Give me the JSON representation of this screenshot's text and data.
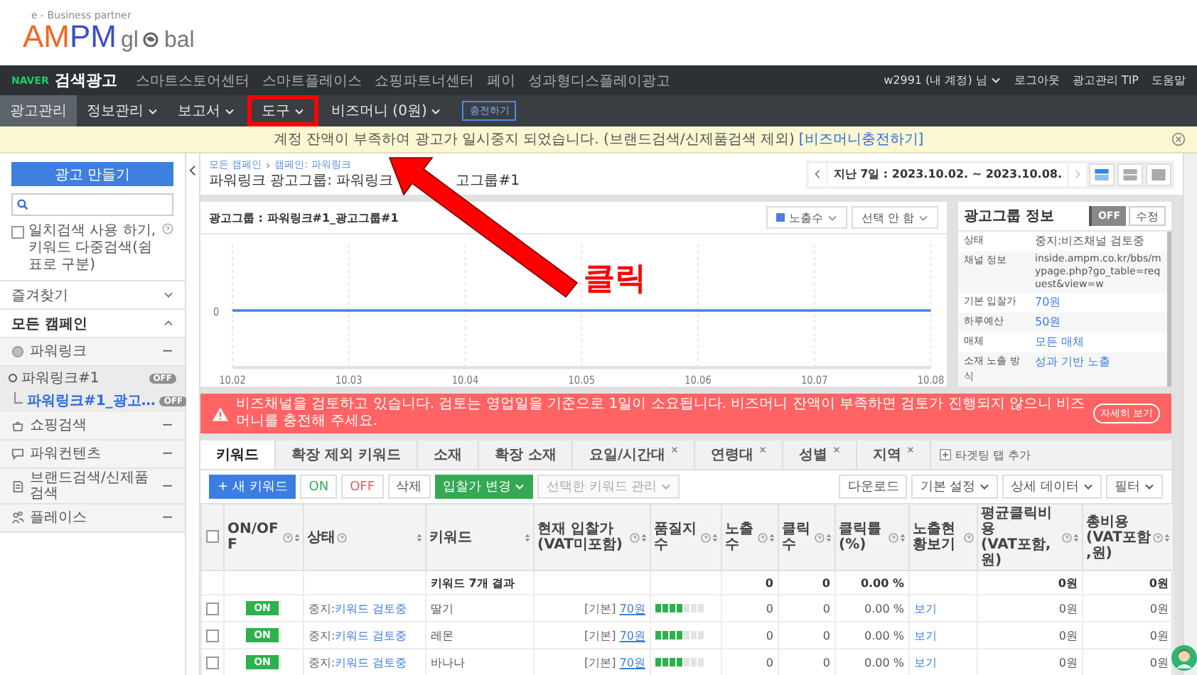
{
  "logo": {
    "tagline": "e - Business partner",
    "brand_a": "AM",
    "brand_b": "PM",
    "word_start": "gl",
    "word_end": "bal"
  },
  "topbar": {
    "brand_mark": "NAVER",
    "brand": "검색광고",
    "links": [
      "스마트스토어센터",
      "스마트플레이스",
      "쇼핑파트너센터",
      "페이",
      "성과형디스플레이광고"
    ],
    "account": "w2991 (내 계정) 님",
    "right_links": [
      "로그아웃",
      "광고관리 TIP",
      "도움말"
    ]
  },
  "nav": {
    "items": [
      {
        "label": "광고관리",
        "dropdown": false,
        "selected": true,
        "highlighted": false
      },
      {
        "label": "정보관리",
        "dropdown": true,
        "selected": false,
        "highlighted": false
      },
      {
        "label": "보고서",
        "dropdown": true,
        "selected": false,
        "highlighted": false
      },
      {
        "label": "도구",
        "dropdown": true,
        "selected": false,
        "highlighted": true
      },
      {
        "label": "비즈머니 (0원)",
        "dropdown": true,
        "selected": false,
        "highlighted": false
      }
    ],
    "charge_button": "충전하기"
  },
  "notice": {
    "text": "계정 잔액이 부족하여 광고가 일시중지 되었습니다. (브랜드검색/신제품검색 제외)",
    "link": "[비즈머니충전하기]"
  },
  "sidebar": {
    "create_button": "광고 만들기",
    "option": {
      "label": "일치검색 사용 하기, 키워드 다중검색(쉼표로 구분)",
      "checked": false
    },
    "sections": [
      {
        "label": "즐겨찾기",
        "expanded": false
      },
      {
        "label": "모든 캠페인",
        "expanded": true
      }
    ],
    "campaign_types": [
      {
        "kind": "circle",
        "label": "파워링크",
        "toggle": "−",
        "children": [
          {
            "label": "파워링크#1",
            "badge": "OFF",
            "selected": false,
            "children": [
              {
                "label": "파워링크#1_광고…",
                "badge": "OFF",
                "selected": true
              }
            ]
          }
        ]
      },
      {
        "kind": "bag",
        "label": "쇼핑검색",
        "toggle": "−"
      },
      {
        "kind": "chat",
        "label": "파워컨텐츠",
        "toggle": "−"
      },
      {
        "kind": "doc",
        "label": "브랜드검색/신제품검색",
        "toggle": "−"
      },
      {
        "kind": "people",
        "label": "플레이스",
        "toggle": "−"
      }
    ]
  },
  "header": {
    "breadcrumb": [
      "모든 캠페인",
      "캠페인: 파워링크"
    ],
    "title_parts": [
      "파워링크 광고그룹: 파워링크",
      "고그룹#1"
    ],
    "date_range": "지난 7일 : 2023.10.02. ~ 2023.10.08.",
    "views": [
      {
        "kind": "chart",
        "selected": true
      },
      {
        "kind": "split",
        "selected": false
      },
      {
        "kind": "table",
        "selected": false
      }
    ]
  },
  "chart_card": {
    "title": "광고그룹 : 파워링크#1_광고그룹#1",
    "metric_select": "노출수",
    "compare_select": "선택 안 함",
    "y_labels": [
      "0"
    ],
    "x_labels": [
      "10.02",
      "10.03",
      "10.04",
      "10.05",
      "10.06",
      "10.07",
      "10.08"
    ]
  },
  "info_panel": {
    "title": "광고그룹 정보",
    "toggle": {
      "label": "OFF",
      "on": false
    },
    "edit_button": "수정",
    "rows": [
      {
        "label": "상태",
        "value": "중지:비즈채널 검토중",
        "kind": "text"
      },
      {
        "label": "채널 정보",
        "value": "inside.ampm.co.kr/bbs/mypage.php?go_table=request&view=w",
        "kind": "url"
      },
      {
        "label": "기본 입찰가",
        "value": "70원",
        "kind": "link"
      },
      {
        "label": "하루예산",
        "value": "50원",
        "kind": "link"
      },
      {
        "label": "매체",
        "value": "모든 매체",
        "kind": "link"
      },
      {
        "label": "소재 노출 방식",
        "value": "성과 기반 노출",
        "kind": "link"
      }
    ]
  },
  "alert": {
    "text": "비즈채널을 검토하고 있습니다. 검토는 영업일을 기준으로 1일이 소요됩니다. 비즈머니 잔액이 부족하면 검토가 진행되지 않으니 비즈머니를 충전해 주세요.",
    "button": "자세히 보기"
  },
  "tabs": [
    {
      "label": "키워드",
      "closable": false,
      "selected": true
    },
    {
      "label": "확장 제외 키워드",
      "closable": false,
      "selected": false
    },
    {
      "label": "소재",
      "closable": false,
      "selected": false
    },
    {
      "label": "확장 소재",
      "closable": false,
      "selected": false
    },
    {
      "label": "요일/시간대",
      "closable": true,
      "selected": false
    },
    {
      "label": "연령대",
      "closable": true,
      "selected": false
    },
    {
      "label": "성별",
      "closable": true,
      "selected": false
    },
    {
      "label": "지역",
      "closable": true,
      "selected": false
    }
  ],
  "add_tab": "타겟팅 탭 추가",
  "toolbar": {
    "left": [
      {
        "kind": "primary",
        "label": "+ 새 키워드",
        "dropdown": false
      },
      {
        "kind": "on",
        "label": "ON",
        "dropdown": false
      },
      {
        "kind": "off",
        "label": "OFF",
        "dropdown": false
      },
      {
        "kind": "plain",
        "label": "삭제",
        "dropdown": false
      },
      {
        "kind": "green",
        "label": "입찰가 변경",
        "dropdown": true
      },
      {
        "kind": "disabled",
        "label": "선택한 키워드 관리",
        "dropdown": true
      }
    ],
    "right": [
      {
        "label": "다운로드",
        "dropdown": false
      },
      {
        "label": "기본 설정",
        "dropdown": true
      },
      {
        "label": "상세 데이터",
        "dropdown": true
      },
      {
        "label": "필터",
        "dropdown": true
      }
    ]
  },
  "table": {
    "columns": [
      {
        "kind": "checkbox",
        "checked": false
      },
      {
        "kind": "text",
        "label": "ON/OFF",
        "help": true,
        "sortable": true
      },
      {
        "kind": "text",
        "label": "상태",
        "help": true,
        "sortable": true
      },
      {
        "kind": "text",
        "label": "키워드",
        "help": false,
        "sortable": true
      },
      {
        "kind": "text",
        "label": "현재 입찰가(VAT미포함)",
        "help": true,
        "sortable": true
      },
      {
        "kind": "text",
        "label": "품질지수",
        "help": true,
        "sortable": true
      },
      {
        "kind": "text",
        "label": "노출수",
        "help": true,
        "sortable": true
      },
      {
        "kind": "text",
        "label": "클릭수",
        "help": true,
        "sortable": true
      },
      {
        "kind": "text",
        "label": "클릭률(%)",
        "help": true,
        "sortable": true
      },
      {
        "kind": "text",
        "label": "노출현황보기",
        "help": true,
        "sortable": false
      },
      {
        "kind": "text",
        "label": "평균클릭비용(VAT포함,원)",
        "help": true,
        "sortable": true
      },
      {
        "kind": "text",
        "label": "총비용(VAT포함,원)",
        "help": true,
        "sortable": true
      }
    ],
    "summary": {
      "label": "키워드 7개 결과",
      "impressions": "0",
      "clicks": "0",
      "ctr": "0.00 %",
      "avg_cpc": "0원",
      "cost": "0원"
    },
    "rows": [
      {
        "checked": false,
        "on": true,
        "toggle_label": "ON",
        "status_prefix": "중지:",
        "status_link": "키워드 검토중",
        "keyword": "딸기",
        "bid_prefix": "[기본]",
        "bid": "70원",
        "quality": {
          "level": 0.57
        },
        "impressions": "0",
        "clicks": "0",
        "ctr": "0.00 %",
        "view_link": "보기",
        "avg_cpc": "0원",
        "cost": "0원"
      },
      {
        "checked": false,
        "on": true,
        "toggle_label": "ON",
        "status_prefix": "중지:",
        "status_link": "키워드 검토중",
        "keyword": "레몬",
        "bid_prefix": "[기본]",
        "bid": "70원",
        "quality": {
          "level": 0.57
        },
        "impressions": "0",
        "clicks": "0",
        "ctr": "0.00 %",
        "view_link": "보기",
        "avg_cpc": "0원",
        "cost": "0원"
      },
      {
        "checked": false,
        "on": true,
        "toggle_label": "ON",
        "status_prefix": "중지:",
        "status_link": "키워드 검토중",
        "keyword": "바나나",
        "bid_prefix": "[기본]",
        "bid": "70원",
        "quality": {
          "level": 0.57
        },
        "impressions": "0",
        "clicks": "0",
        "ctr": "0.00 %",
        "view_link": "보기",
        "avg_cpc": "0원",
        "cost": "0원"
      }
    ]
  },
  "annotation": {
    "label": "클릭"
  }
}
